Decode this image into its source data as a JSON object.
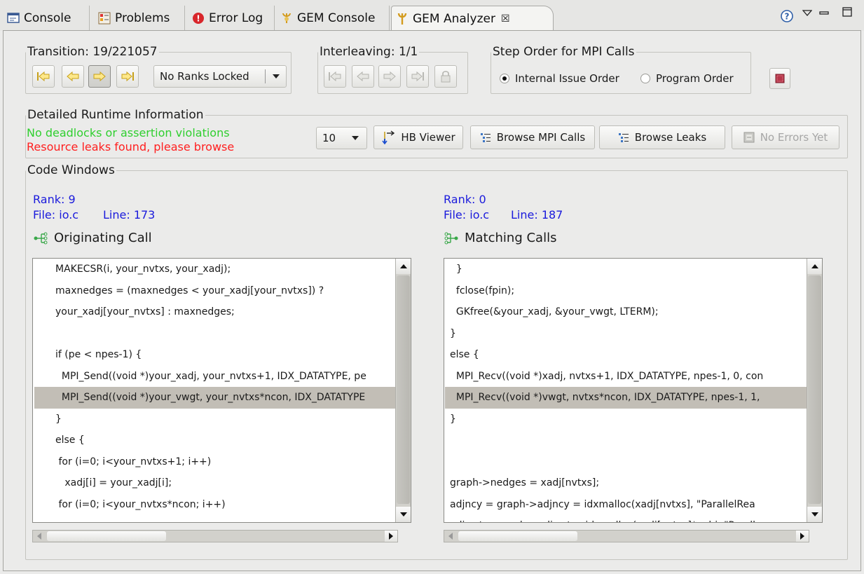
{
  "tabs": [
    {
      "label": "Console",
      "icon": "console-icon"
    },
    {
      "label": "Problems",
      "icon": "problems-icon"
    },
    {
      "label": "Error Log",
      "icon": "error-log-icon"
    },
    {
      "label": "GEM Console",
      "icon": "gem-console-icon"
    },
    {
      "label": "GEM Analyzer",
      "icon": "gem-analyzer-icon",
      "close": "☒"
    }
  ],
  "transition": {
    "title": "Transition: 19/221057",
    "ranks_combo": "No Ranks Locked"
  },
  "interleaving": {
    "title": "Interleaving: 1/1"
  },
  "step_order": {
    "title": "Step Order for MPI Calls",
    "option_internal": "Internal Issue Order",
    "option_program": "Program Order",
    "selected": "Internal Issue Order"
  },
  "runtime": {
    "title": "Detailed Runtime Information",
    "status_ok": "No deadlocks or assertion violations",
    "status_leak": "Resource leaks found, please browse",
    "count_combo": "10",
    "hb_viewer": "HB Viewer",
    "browse_mpi": "Browse MPI Calls",
    "browse_leaks": "Browse Leaks",
    "no_errors": "No Errors Yet",
    "color_ok": "#2fcf2f",
    "color_leak": "#ff2020"
  },
  "code": {
    "title": "Code Windows",
    "left": {
      "rank": "Rank: 9",
      "file": "File: io.c",
      "line": "Line: 173",
      "heading": "Originating Call",
      "lines": [
        "MAKECSR(i, your_nvtxs, your_xadj);",
        "maxnedges = (maxnedges < your_xadj[your_nvtxs]) ?",
        "your_xadj[your_nvtxs] : maxnedges;",
        "",
        "if (pe < npes-1) {",
        "  MPI_Send((void *)your_xadj, your_nvtxs+1, IDX_DATATYPE, pe",
        "  MPI_Send((void *)your_vwgt, your_nvtxs*ncon, IDX_DATATYPE",
        "}",
        "else {",
        " for (i=0; i<your_nvtxs+1; i++)",
        "   xadj[i] = your_xadj[i];",
        " for (i=0; i<your_nvtxs*ncon; i++)"
      ],
      "highlight_index": 6
    },
    "right": {
      "rank": "Rank: 0",
      "file": "File: io.c",
      "line": "Line: 187",
      "heading": "Matching Calls",
      "lines": [
        "  }",
        "  fclose(fpin);",
        "  GKfree(&your_xadj, &your_vwgt, LTERM);",
        "}",
        "else {",
        "  MPI_Recv((void *)xadj, nvtxs+1, IDX_DATATYPE, npes-1, 0, con",
        "  MPI_Recv((void *)vwgt, nvtxs*ncon, IDX_DATATYPE, npes-1, 1,",
        "}",
        "",
        "",
        "graph->nedges = xadj[nvtxs];",
        "adjncy = graph->adjncy = idxmalloc(xadj[nvtxs], \"ParallelRea",
        "adjwgt = graph->adjwgt = idxmalloc(xadj[nvtxs]*nobj, \"Parall"
      ],
      "highlight_index": 6
    }
  }
}
